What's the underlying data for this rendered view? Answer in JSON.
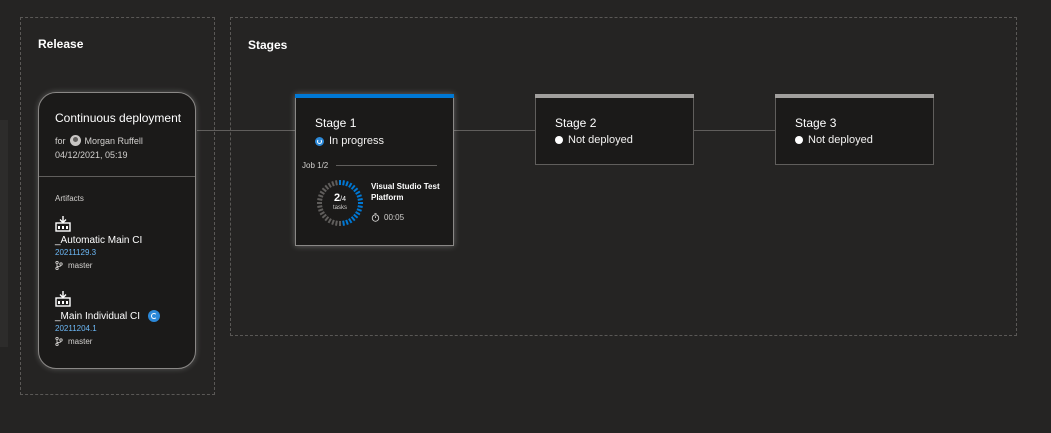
{
  "release": {
    "panel_title": "Release",
    "card": {
      "title": "Continuous deployment",
      "for_label": "for",
      "user": "Morgan Ruffell",
      "date": "04/12/2021, 05:19",
      "artifacts_label": "Artifacts",
      "artifacts": [
        {
          "name": "_Automatic Main CI",
          "version": "20211129.3",
          "branch": "master",
          "icon": "build-artifact-icon"
        },
        {
          "name": "_Main Individual CI",
          "version": "20211204.1",
          "branch": "master",
          "icon": "build-artifact-icon",
          "badge_icon": "trigger-badge-icon"
        }
      ]
    }
  },
  "stages_panel": {
    "title": "Stages",
    "stages": [
      {
        "name": "Stage 1",
        "status": "In progress",
        "status_icon": "in-progress-icon",
        "job_label": "Job 1/2",
        "tasks_done": "2",
        "tasks_total": "/4",
        "tasks_label": "tasks",
        "progress_fraction": 0.5,
        "task_name": "Visual Studio Test Platform",
        "elapsed": "00:05",
        "accent_color": "#0078d4"
      },
      {
        "name": "Stage 2",
        "status": "Not deployed",
        "status_icon": "not-deployed-icon"
      },
      {
        "name": "Stage 3",
        "status": "Not deployed",
        "status_icon": "not-deployed-icon"
      }
    ]
  }
}
